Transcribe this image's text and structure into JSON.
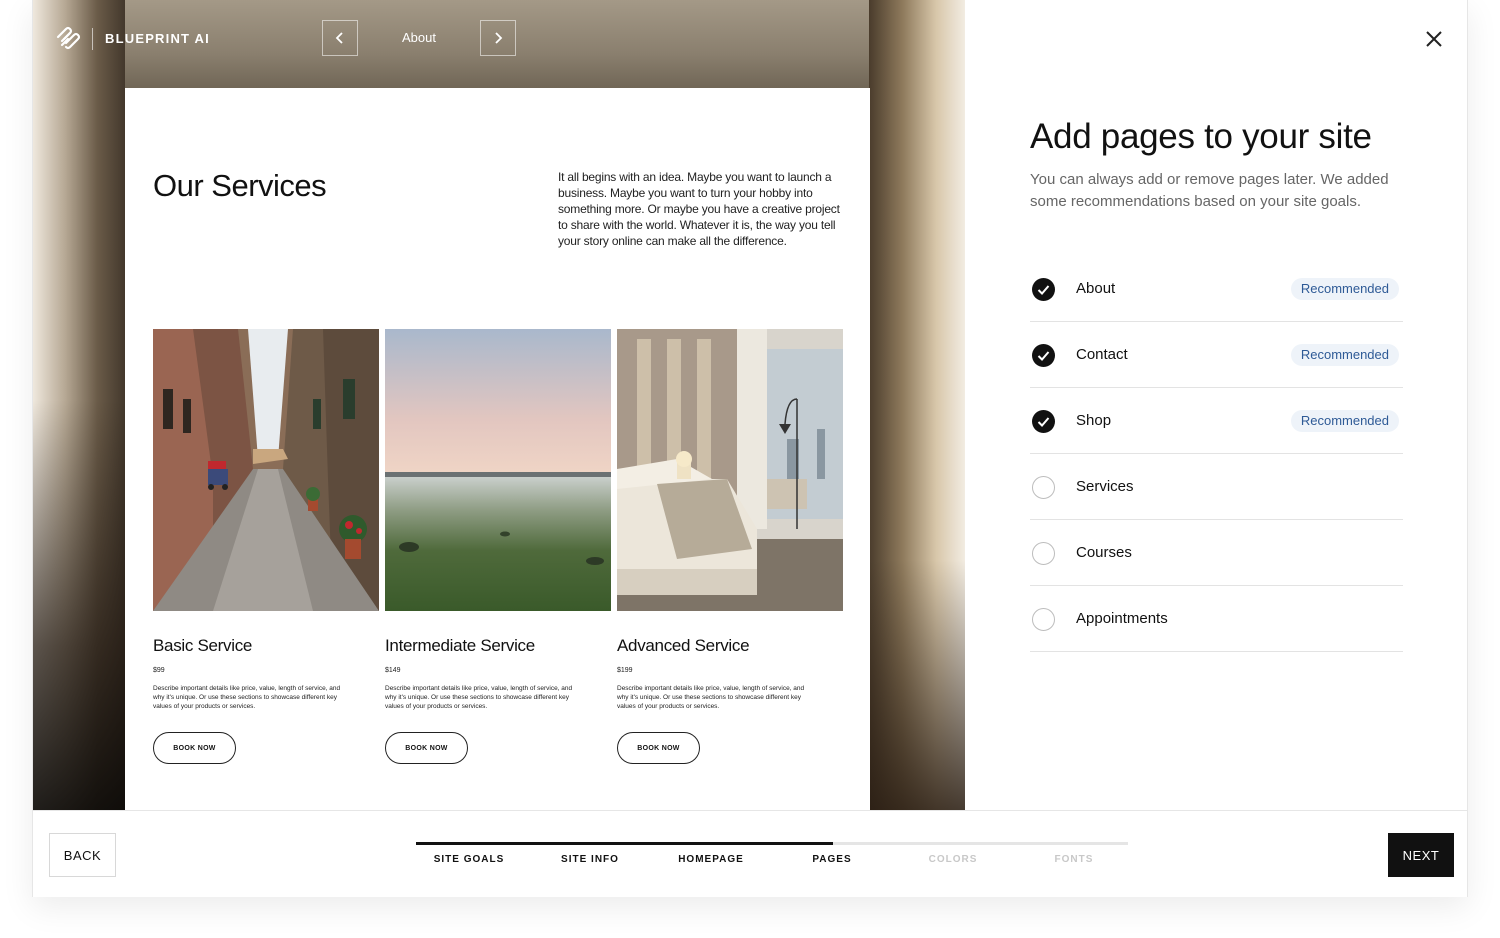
{
  "brand": {
    "name": "BLUEPRINT AI"
  },
  "preview": {
    "current_page": "About",
    "page": {
      "title": "Our Services",
      "intro": "It all begins with an idea. Maybe you want to launch a business. Maybe you want to turn your hobby into something more. Or maybe you have a creative project to share with the world. Whatever it is, the way you tell your story online can make all the difference.",
      "services": [
        {
          "name": "Basic Service",
          "price": "$99",
          "description": "Describe important details like price, value, length of service, and why it's unique. Or use these sections to showcase different key values of your products or services.",
          "button": "BOOK NOW"
        },
        {
          "name": "Intermediate Service",
          "price": "$149",
          "description": "Describe important details like price, value, length of service, and why it's unique. Or use these sections to showcase different key values of your products or services.",
          "button": "BOOK NOW"
        },
        {
          "name": "Advanced Service",
          "price": "$199",
          "description": "Describe important details like price, value, length of service, and why it's unique. Or use these sections to showcase different key values of your products or services.",
          "button": "BOOK NOW"
        }
      ]
    }
  },
  "panel": {
    "heading": "Add pages to your site",
    "subtext": "You can always add or remove pages later. We added some recommendations based on your site goals.",
    "pages": [
      {
        "label": "About",
        "checked": true,
        "badge": "Recommended"
      },
      {
        "label": "Contact",
        "checked": true,
        "badge": "Recommended"
      },
      {
        "label": "Shop",
        "checked": true,
        "badge": "Recommended"
      },
      {
        "label": "Services",
        "checked": false,
        "badge": ""
      },
      {
        "label": "Courses",
        "checked": false,
        "badge": ""
      },
      {
        "label": "Appointments",
        "checked": false,
        "badge": ""
      }
    ]
  },
  "footer": {
    "back_label": "BACK",
    "next_label": "NEXT",
    "progress_fraction": 0.585,
    "steps": [
      {
        "label": "SITE GOALS",
        "active": true
      },
      {
        "label": "SITE INFO",
        "active": true
      },
      {
        "label": "HOMEPAGE",
        "active": true
      },
      {
        "label": "PAGES",
        "active": true
      },
      {
        "label": "COLORS",
        "active": false
      },
      {
        "label": "FONTS",
        "active": false
      }
    ]
  },
  "colors": {
    "accent": "#111111",
    "badge_bg": "#eef3f9",
    "badge_text": "#2e5a96"
  }
}
